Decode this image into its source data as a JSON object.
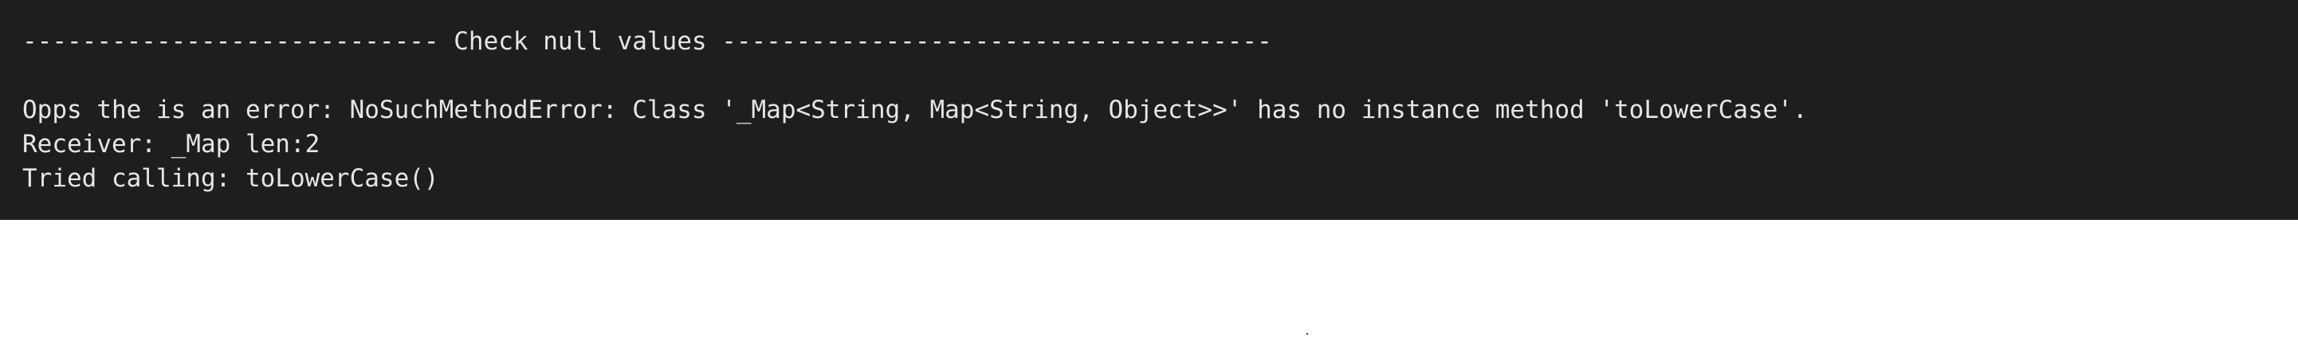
{
  "console": {
    "header": "---------------------------- Check null values -------------------------------------",
    "lines": [
      "Opps the is an error: NoSuchMethodError: Class '_Map<String, Map<String, Object>>' has no instance method 'toLowerCase'.",
      "Receiver: _Map len:2",
      "Tried calling: toLowerCase()"
    ]
  },
  "colors": {
    "background": "#1e1e1e",
    "text": "#e6e6e6"
  }
}
